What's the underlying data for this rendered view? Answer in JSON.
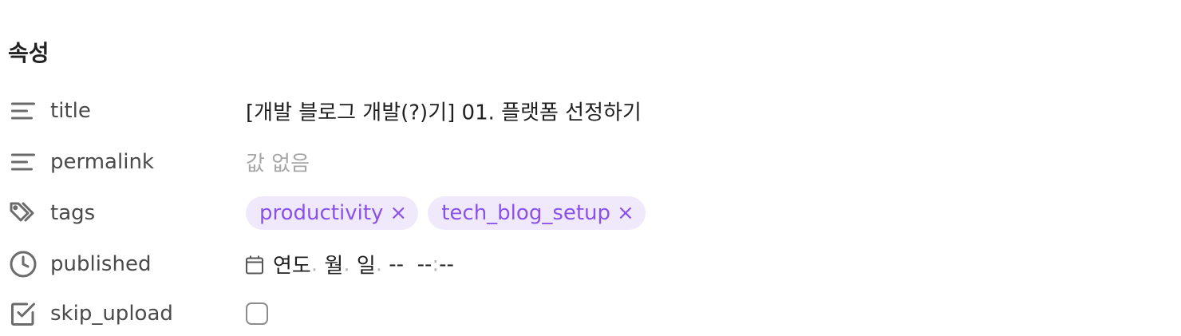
{
  "section": {
    "title": "속성"
  },
  "properties": [
    {
      "key": "title",
      "icon": "text-lines-icon",
      "value": "[개발 블로그 개발(?)기] 01. 플랫폼 선정하기"
    },
    {
      "key": "permalink",
      "icon": "text-lines-icon",
      "placeholder": "값 없음"
    },
    {
      "key": "tags",
      "icon": "tags-icon",
      "tags": [
        "productivity",
        "tech_blog_setup"
      ],
      "remove_glyph": "×"
    },
    {
      "key": "published",
      "icon": "clock-icon",
      "date": {
        "year": "연도",
        "month": "월",
        "day": "일",
        "dot": ".",
        "ampm": "--",
        "hour": "--",
        "colon": ":",
        "minute": "--"
      }
    },
    {
      "key": "skip_upload",
      "icon": "checkbox-icon",
      "checked": false
    }
  ],
  "colors": {
    "tag_bg": "#efe9fb",
    "tag_text": "#8a52e6",
    "icon": "#6b6b6b",
    "placeholder": "#a6a6a6"
  }
}
